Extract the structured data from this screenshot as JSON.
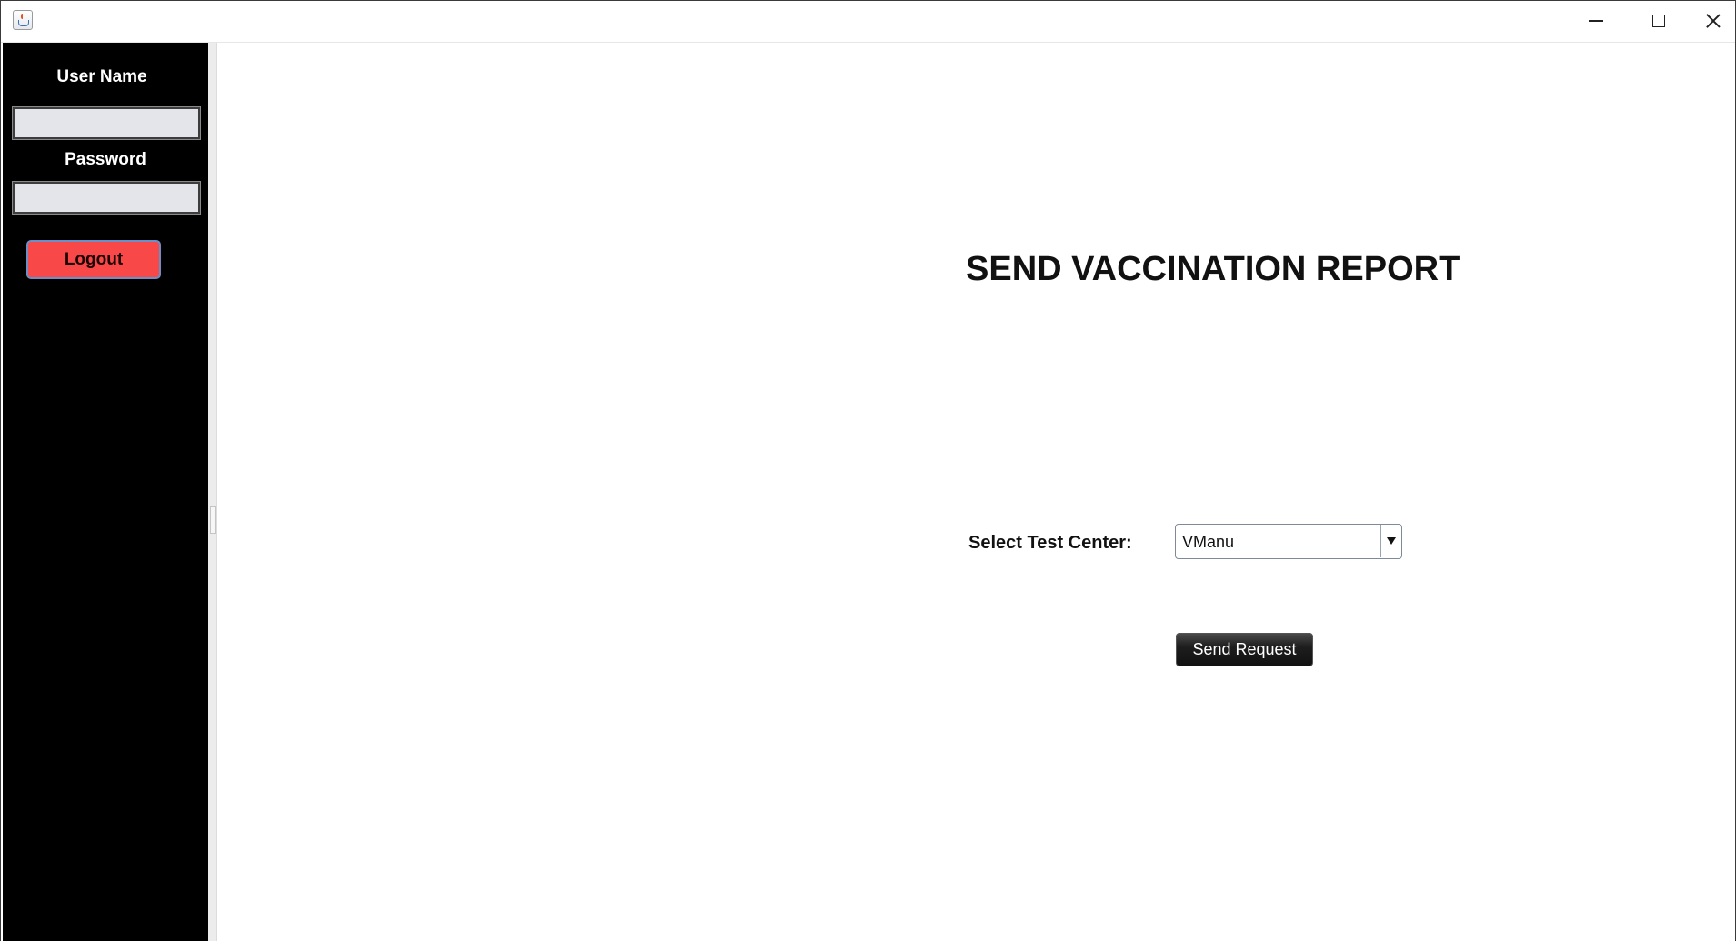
{
  "window": {
    "app_icon": "java-cup-icon",
    "controls": {
      "minimize_icon": "minimize-icon",
      "maximize_icon": "maximize-icon",
      "close_icon": "close-icon"
    }
  },
  "sidebar": {
    "username_label": "User Name",
    "username_value": "",
    "password_label": "Password",
    "password_value": "",
    "logout_label": "Logout",
    "logout_color": "#f84848",
    "background": "#000000"
  },
  "main": {
    "title": "SEND VACCINATION REPORT",
    "select_label": "Select Test Center:",
    "test_center_selected": "VManu",
    "send_button_label": "Send Request"
  }
}
